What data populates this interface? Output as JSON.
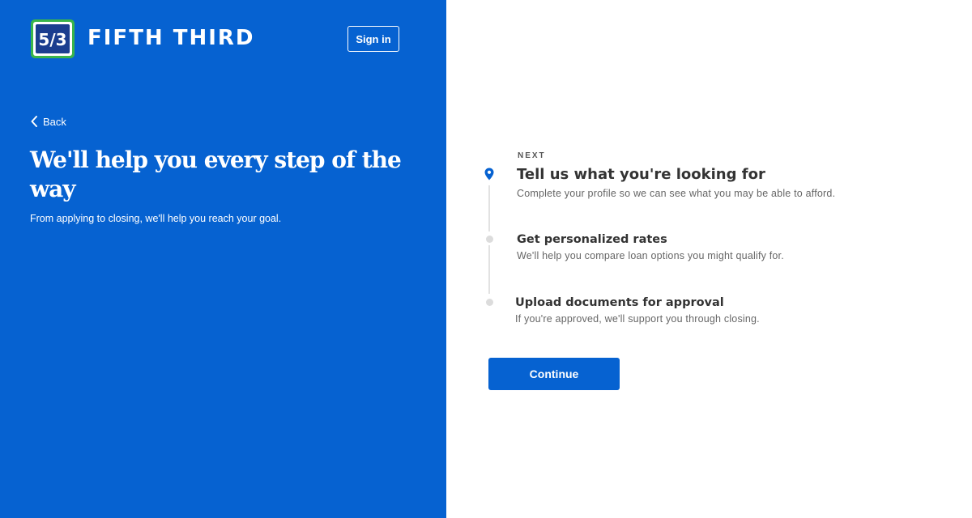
{
  "brand": {
    "name": "FIFTH THIRD",
    "logo_mark": "5/3",
    "logo_icon": "fifth-third-logo-icon"
  },
  "header": {
    "sign_in_label": "Sign in"
  },
  "nav": {
    "back_label": "Back",
    "back_icon": "chevron-left-icon"
  },
  "hero": {
    "headline": "We'll help you every step of the way",
    "subheadline": "From applying to closing, we'll help you reach your goal."
  },
  "steps": {
    "next_label": "NEXT",
    "current_icon": "location-pin-icon",
    "items": [
      {
        "title": "Tell us what you're looking for",
        "description": "Complete your profile so we can see what you may be able to afford."
      },
      {
        "title": "Get personalized rates",
        "description": "We'll help you compare loan options you might qualify for."
      },
      {
        "title": "Upload documents for approval",
        "description": "If you're approved, we'll support you through closing."
      }
    ]
  },
  "actions": {
    "continue_label": "Continue"
  },
  "colors": {
    "brand_blue": "#0662D1",
    "logo_green": "#3AB54A",
    "logo_navy": "#1B3E8F",
    "step_line": "#E2E2E2",
    "title_text": "#333333",
    "body_text": "#666666"
  }
}
